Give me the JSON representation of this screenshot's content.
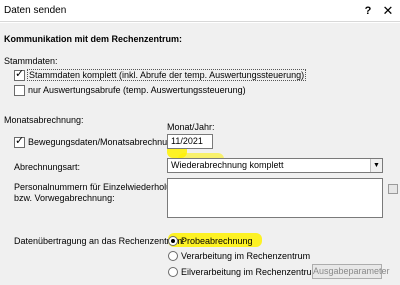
{
  "window": {
    "title": "Daten senden",
    "help_glyph": "?",
    "close_glyph": "✕"
  },
  "main": {
    "heading": "Kommunikation mit dem Rechenzentrum:"
  },
  "stammdaten": {
    "section_label": "Stammdaten:",
    "komplett": {
      "label": "Stammdaten komplett (inkl. Abrufe der temp. Auswertungssteuerung)",
      "checked": true
    },
    "nur_auswertung": {
      "label": "nur Auswertungsabrufe (temp. Auswertungssteuerung)",
      "checked": false
    }
  },
  "monatsabrechnung": {
    "section_label": "Monatsabrechnung:",
    "bewegungsdaten": {
      "label": "Bewegungsdaten/Monatsabrechnung",
      "checked": true
    },
    "monat_jahr": {
      "label": "Monat/Jahr:",
      "value": "11/2021"
    },
    "abrechnungsart": {
      "label": "Abrechnungsart:",
      "value": "Wiederabrechnung komplett"
    },
    "personalnummern": {
      "label_line1": "Personalnummern für Einzelwiederholung",
      "label_line2": "bzw. Vorwegabrechnung:",
      "value": ""
    }
  },
  "datenuebertragung": {
    "label": "Datenübertragung an das Rechenzentrum:",
    "options": [
      {
        "label": "Probeabrechnung",
        "selected": true
      },
      {
        "label": "Verarbeitung im Rechenzentrum",
        "selected": false
      },
      {
        "label": "Eilverarbeitung im Rechenzentrum",
        "selected": false
      }
    ],
    "ausgabe_button": "Ausgabeparameter"
  },
  "highlight_color": "#fff200"
}
